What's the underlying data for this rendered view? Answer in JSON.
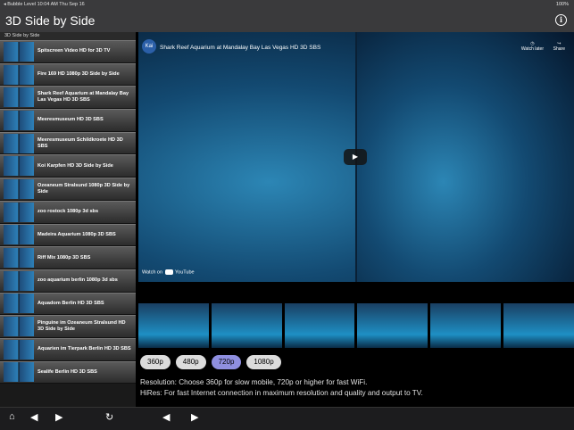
{
  "status_bar": {
    "left": "◂ Bubble Level   10:04 AM   Thu Sep 16",
    "right": "100%"
  },
  "nav": {
    "title": "3D Side by Side",
    "info_icon": "info-icon"
  },
  "sidebar": {
    "header": "3D Side by Side",
    "items": [
      {
        "label": "Spitscreen Video HD for 3D TV"
      },
      {
        "label": "Fire 169 HD 1080p 3D Side by Side"
      },
      {
        "label": "Shark Reef Aquarium at Mandalay Bay Las Vegas HD 3D SBS"
      },
      {
        "label": "Meeresmuseum HD 3D SBS"
      },
      {
        "label": "Meeresmuseum Schildkroete HD 3D SBS"
      },
      {
        "label": "Koi Karpfen HD 3D Side by Side"
      },
      {
        "label": "Ozeaneum Stralsund 1080p 3D Side by Side"
      },
      {
        "label": "zoo rostock 1080p 3d sbs"
      },
      {
        "label": "Madeira Aquarium 1080p 3D SBS"
      },
      {
        "label": "Riff Mix 1080p 3D SBS"
      },
      {
        "label": "zoo aquarium berlin 1080p 3d sbs"
      },
      {
        "label": "Aquadom Berlin HD 3D SBS"
      },
      {
        "label": "Pinguine im Ozeaneum Stralsund HD 3D Side by Side"
      },
      {
        "label": "Aquarien im Tierpark Berlin HD 3D SBS"
      },
      {
        "label": "Sealife Berlin HD 3D SBS"
      }
    ]
  },
  "video": {
    "channel": "Kai",
    "title": "Shark Reef Aquarium at Mandalay Bay Las Vegas HD 3D SBS",
    "watch_later": "Watch later",
    "share": "Share",
    "watch_on": "Watch on",
    "youtube": "YouTube"
  },
  "resolutions": {
    "options": [
      "360p",
      "480p",
      "720p",
      "1080p"
    ],
    "selected": "720p"
  },
  "info": {
    "line1": "Resolution: Choose 360p for slow mobile, 720p or higher for fast WiFi.",
    "line2": "HiRes: For fast Internet connection in maximum resolution and quality and output to TV."
  }
}
